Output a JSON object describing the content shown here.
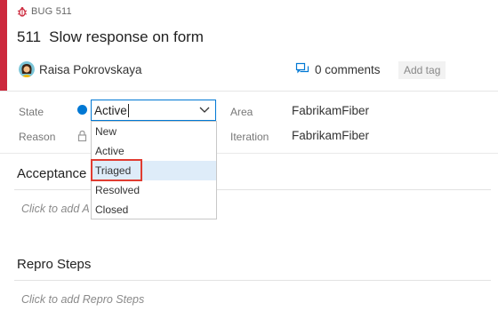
{
  "work_item": {
    "type_label": "BUG 511",
    "id": "511",
    "title": "Slow response on form",
    "assignee": "Raisa Pokrovskaya",
    "comments_label": "0 comments",
    "add_tag_label": "Add tag"
  },
  "fields": {
    "state_label": "State",
    "reason_label": "Reason",
    "area_label": "Area",
    "iteration_label": "Iteration",
    "state_value": "Active",
    "area_value": "FabrikamFiber",
    "iteration_value": "FabrikamFiber"
  },
  "state_dropdown": {
    "options": [
      "New",
      "Active",
      "Triaged",
      "Resolved",
      "Closed"
    ],
    "highlighted": "Triaged"
  },
  "sections": {
    "acceptance_title": "Acceptance",
    "acceptance_placeholder": "Click to add A",
    "repro_title": "Repro Steps",
    "repro_placeholder": "Click to add Repro Steps"
  },
  "colors": {
    "bug_accent": "#cc293d",
    "state_active": "#0078d4",
    "focus_border": "#0078d4",
    "highlight_box": "#e03c31",
    "option_hover": "#deecf9"
  },
  "icons": {
    "bug": "bug-icon",
    "comments": "comment-icon",
    "state": "state-dot-icon",
    "reason": "lock-icon",
    "dropdown": "chevron-down-icon"
  }
}
